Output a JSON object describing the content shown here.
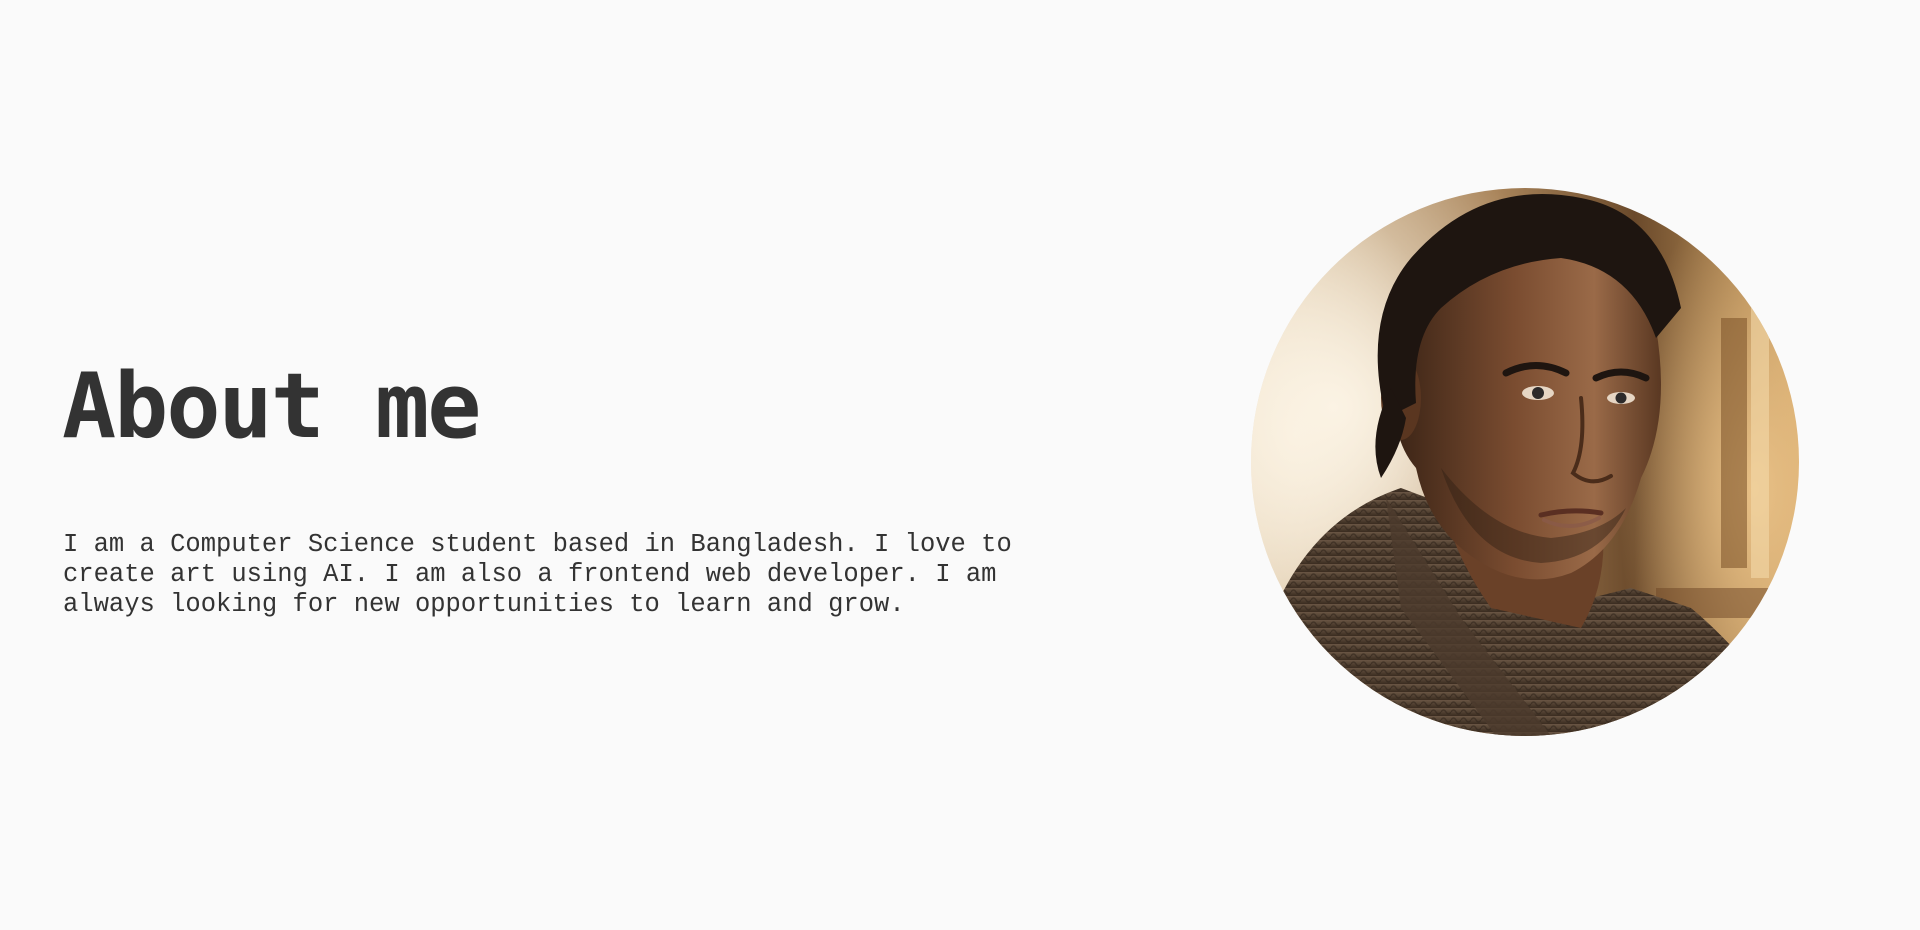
{
  "about": {
    "heading": "About me",
    "description": "I am a Computer Science student based in Bangladesh. I love to create art using AI. I am also a frontend web developer. I am always looking for new opportunities to learn and grow."
  },
  "portrait": {
    "alt": "Portrait of a man in a knit sweater",
    "colors": {
      "background_light": "#f3e6d0",
      "background_warm": "#c79555",
      "skin": "#8a5a3a",
      "hair": "#1e1510",
      "sweater": "#5a4838"
    }
  },
  "theme": {
    "page_background": "#fafafa",
    "text_color": "#333333"
  }
}
